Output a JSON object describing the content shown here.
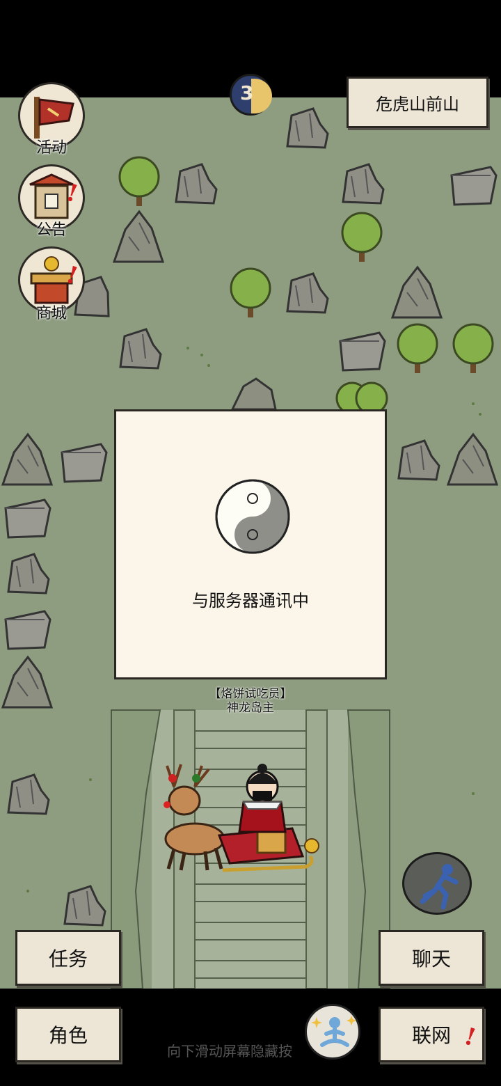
{
  "location": {
    "name": "危虎山前山"
  },
  "moon": {
    "day": "3"
  },
  "side_menu": {
    "activity": "活动",
    "notice": "公告",
    "shop": "商城"
  },
  "dialog": {
    "message": "与服务器通讯中"
  },
  "character": {
    "title": "【烙饼试吃员】",
    "name": "神龙岛主"
  },
  "buttons": {
    "tasks": "任务",
    "chat": "聊天",
    "role": "角色",
    "network": "联网"
  },
  "hint": "向下滑动屏幕隐藏按",
  "colors": {
    "grass": "#8e9c80",
    "path": "#a9b49a",
    "panel": "#fbf6e9",
    "alert": "#d42020"
  }
}
